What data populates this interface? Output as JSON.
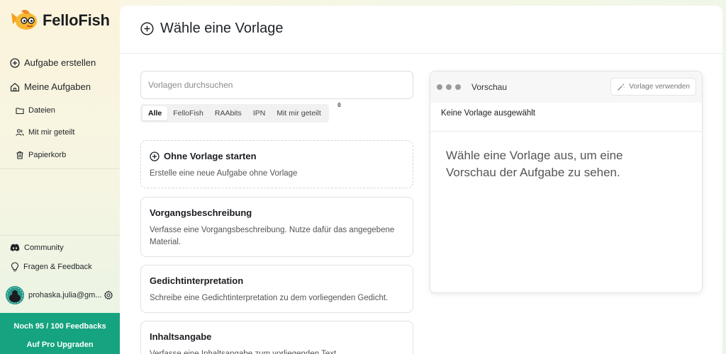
{
  "app": {
    "name": "FelloFish"
  },
  "sidebar": {
    "create_task": "Aufgabe erstellen",
    "my_tasks": "Meine Aufgaben",
    "sub_items": [
      {
        "label": "Dateien",
        "icon": "folder-icon"
      },
      {
        "label": "Mit mir geteilt",
        "icon": "users-icon"
      },
      {
        "label": "Papierkorb",
        "icon": "trash-icon"
      }
    ],
    "community": "Community",
    "feedback": "Fragen & Feedback",
    "user_email": "prohaska.julia@gm...",
    "promo_line1": "Noch 95 / 100 Feedbacks",
    "promo_line2": "Auf Pro Upgraden"
  },
  "main": {
    "title": "Wähle eine Vorlage",
    "search_placeholder": "Vorlagen durchsuchen",
    "filters": [
      "Alle",
      "FelloFish",
      "RAAbits",
      "IPN",
      "Mit mir geteilt"
    ],
    "active_filter": "Alle",
    "filter_badge": "0",
    "cards": [
      {
        "title": "Ohne Vorlage starten",
        "desc": "Erstelle eine neue Aufgabe ohne Vorlage"
      },
      {
        "title": "Vorgangsbeschreibung",
        "desc": "Verfasse eine Vorgangsbeschreibung. Nutze dafür das angegebene Material."
      },
      {
        "title": "Gedichtinterpretation",
        "desc": "Schreibe eine Gedichtinterpretation zu dem vorliegenden Gedicht."
      },
      {
        "title": "Inhaltsangabe",
        "desc": "Verfasse eine Inhaltsangabe zum vorliegenden Text."
      }
    ]
  },
  "preview": {
    "title": "Vorschau",
    "use_button": "Vorlage verwenden",
    "selected": "Keine Vorlage ausgewählt",
    "message": "Wähle eine Vorlage aus, um eine Vorschau der Aufgabe zu sehen."
  },
  "colors": {
    "accent": "#16a37f",
    "text": "#1f2328",
    "muted": "#555555"
  }
}
